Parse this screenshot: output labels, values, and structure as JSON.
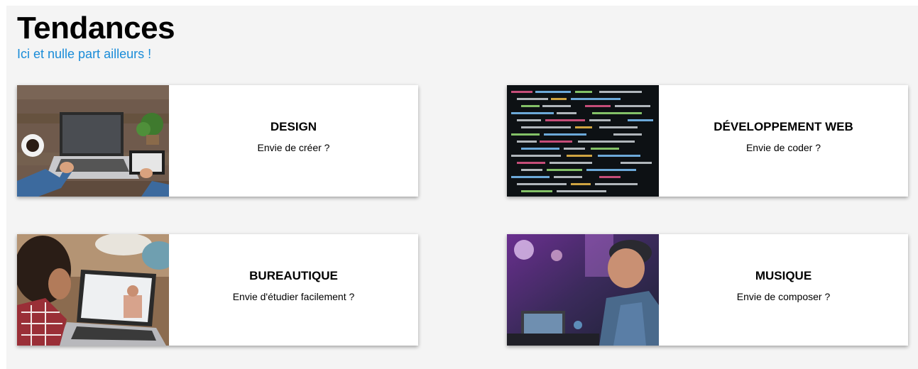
{
  "header": {
    "title": "Tendances",
    "subtitle": "Ici et nulle part ailleurs !"
  },
  "colors": {
    "accent": "#1a8cd8",
    "section_bg": "#f4f4f4",
    "card_bg": "#ffffff"
  },
  "cards": [
    {
      "title": "DESIGN",
      "text": "Envie de créer ?",
      "image": "designer-laptop-photo"
    },
    {
      "title": "DÉVELOPPEMENT WEB",
      "text": "Envie de coder ?",
      "image": "code-screen-photo"
    },
    {
      "title": "BUREAUTIQUE",
      "text": "Envie d'étudier facilement ?",
      "image": "student-laptop-photo"
    },
    {
      "title": "MUSIQUE",
      "text": "Envie de composer ?",
      "image": "music-studio-photo"
    }
  ]
}
